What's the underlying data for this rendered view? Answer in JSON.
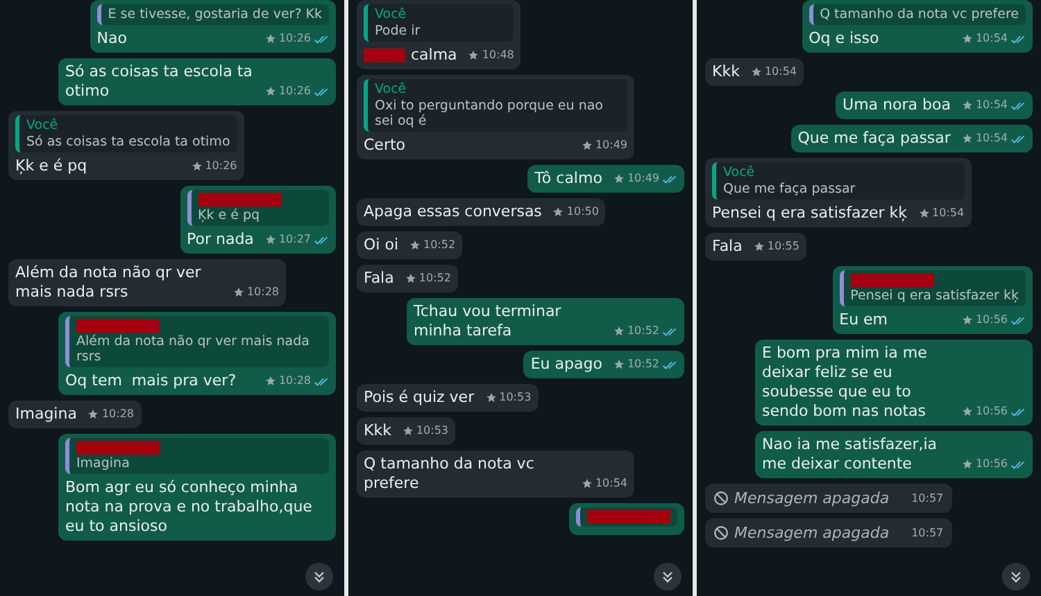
{
  "panels": [
    {
      "messages": [
        {
          "kind": "text",
          "outgoing": true,
          "quote": {
            "text": "E se tivesse, gostaria de ver? Kk"
          },
          "text": "Nao",
          "time": "10:26",
          "starred": true,
          "read": true
        },
        {
          "kind": "text",
          "outgoing": true,
          "text": "Só as coisas ta escola ta otimo",
          "time": "10:26",
          "starred": true,
          "read": true
        },
        {
          "kind": "text",
          "outgoing": false,
          "quote": {
            "author": "Você",
            "text": "Só as coisas ta escola ta otimo"
          },
          "text": "Ķk e é pq",
          "time": "10:26",
          "starred": true
        },
        {
          "kind": "text",
          "outgoing": true,
          "quote": {
            "redacted": true,
            "text": "Ķk e é pq"
          },
          "text": "Por nada",
          "time": "10:27",
          "starred": true,
          "read": true
        },
        {
          "kind": "text",
          "outgoing": false,
          "text": "Além da nota não qr ver mais nada rsrs",
          "time": "10:28",
          "starred": true
        },
        {
          "kind": "text",
          "outgoing": true,
          "quote": {
            "redacted": true,
            "text": "Além da nota não qr ver mais nada rsrs"
          },
          "text": "Oq tem  mais pra ver?",
          "time": "10:28",
          "starred": true,
          "read": true
        },
        {
          "kind": "text",
          "outgoing": false,
          "text": "Imagina",
          "time": "10:28",
          "starred": true
        },
        {
          "kind": "text",
          "outgoing": true,
          "quote": {
            "redacted": true,
            "text": "Imagina"
          },
          "text": "Bom agr eu só conheço minha nota na prova e no trabalho,que eu to ansioso"
        }
      ]
    },
    {
      "messages": [
        {
          "kind": "text",
          "outgoing": false,
          "quote": {
            "author": "Você",
            "text": "Pode ir"
          },
          "redacted_prefix": true,
          "text": "calma",
          "time": "10:48",
          "starred": true
        },
        {
          "kind": "text",
          "outgoing": false,
          "quote": {
            "author": "Você",
            "text": "Oxi to perguntando  porque eu nao sei oq é"
          },
          "text": "Certo",
          "time": "10:49",
          "starred": true
        },
        {
          "kind": "text",
          "outgoing": true,
          "text": "Tô calmo",
          "time": "10:49",
          "starred": true,
          "read": true
        },
        {
          "kind": "text",
          "outgoing": false,
          "text": "Apaga essas conversas",
          "time": "10:50",
          "starred": true
        },
        {
          "kind": "text",
          "outgoing": false,
          "text": "Oi oi",
          "time": "10:52",
          "starred": true
        },
        {
          "kind": "text",
          "outgoing": false,
          "text": "Fala",
          "time": "10:52",
          "starred": true
        },
        {
          "kind": "text",
          "outgoing": true,
          "text": "Tchau vou terminar minha tarefa",
          "time": "10:52",
          "starred": true,
          "read": true
        },
        {
          "kind": "text",
          "outgoing": true,
          "text": "Eu apago",
          "time": "10:52",
          "starred": true,
          "read": true
        },
        {
          "kind": "text",
          "outgoing": false,
          "text": "Pois é quiz ver",
          "time": "10:53",
          "starred": true
        },
        {
          "kind": "text",
          "outgoing": false,
          "text": "Kkk",
          "time": "10:53",
          "starred": true
        },
        {
          "kind": "text",
          "outgoing": false,
          "text": "Q tamanho da nota vc prefere",
          "time": "10:54",
          "starred": true
        },
        {
          "kind": "text",
          "outgoing": true,
          "quote": {
            "redacted": true
          }
        }
      ]
    },
    {
      "messages": [
        {
          "kind": "text",
          "outgoing": true,
          "quote": {
            "text": "Q tamanho da nota vc prefere"
          },
          "text": "Oq e isso",
          "time": "10:54",
          "starred": true,
          "read": true
        },
        {
          "kind": "text",
          "outgoing": false,
          "text": "Kkk",
          "time": "10:54",
          "starred": true
        },
        {
          "kind": "text",
          "outgoing": true,
          "text": "Uma nora boa",
          "time": "10:54",
          "starred": true,
          "read": true
        },
        {
          "kind": "text",
          "outgoing": true,
          "text": "Que me faça passar",
          "time": "10:54",
          "starred": true,
          "read": true
        },
        {
          "kind": "text",
          "outgoing": false,
          "quote": {
            "author": "Você",
            "text": "Que me faça passar"
          },
          "text": "Pensei q era satisfazer kķ",
          "time": "10:54",
          "starred": true
        },
        {
          "kind": "text",
          "outgoing": false,
          "text": "Fala",
          "time": "10:55",
          "starred": true
        },
        {
          "kind": "text",
          "outgoing": true,
          "quote": {
            "redacted": true,
            "text": "Pensei q era satisfazer kķ"
          },
          "text": "Eu em",
          "time": "10:56",
          "starred": true,
          "read": true
        },
        {
          "kind": "text",
          "outgoing": true,
          "text": "E bom pra mim ia me deixar feliz se eu soubesse que eu to sendo bom nas notas",
          "time": "10:56",
          "starred": true,
          "read": true
        },
        {
          "kind": "text",
          "outgoing": true,
          "text": "Nao ia me satisfazer,ia me deixar contente",
          "time": "10:56",
          "starred": true,
          "read": true
        },
        {
          "kind": "deleted",
          "outgoing": false,
          "text": "Mensagem apagada",
          "time": "10:57"
        },
        {
          "kind": "deleted",
          "outgoing": false,
          "text": "Mensagem apagada",
          "time": "10:57"
        }
      ]
    }
  ]
}
